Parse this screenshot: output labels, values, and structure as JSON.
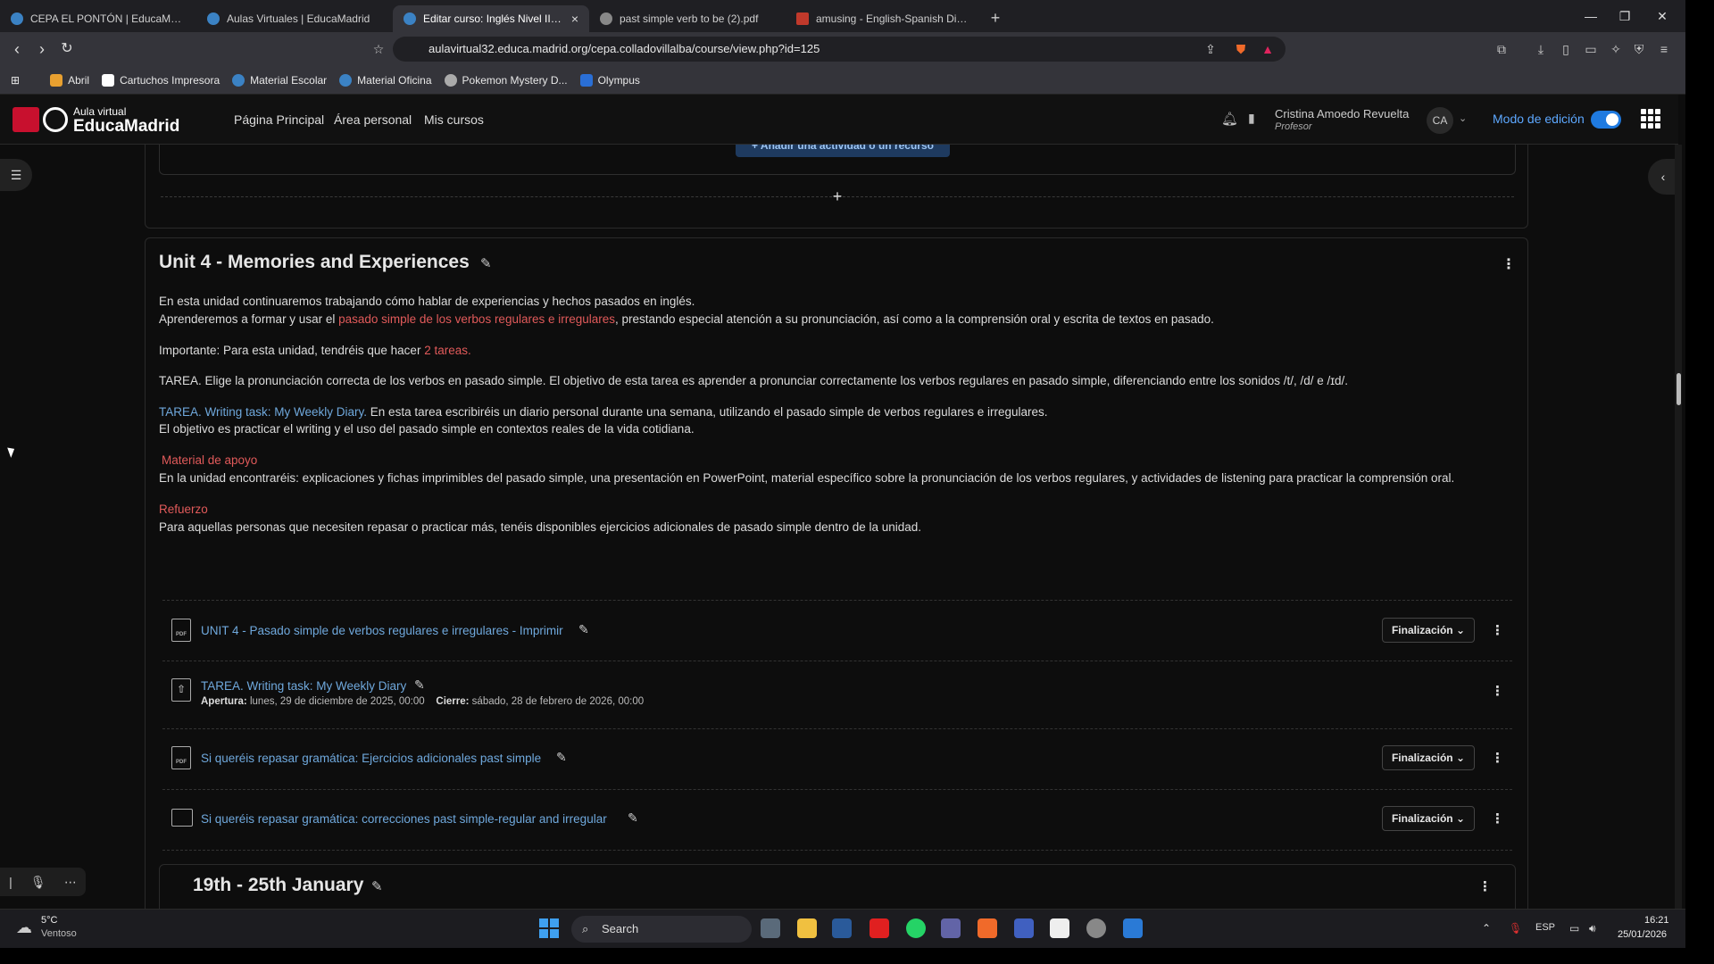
{
  "browser": {
    "tabs": [
      {
        "label": "CEPA EL PONTÓN | EducaMadrid"
      },
      {
        "label": "Aulas Virtuales | EducaMadrid"
      },
      {
        "label": "Editar curso: Inglés Nivel II Dista",
        "active": true
      },
      {
        "label": "past simple verb to be (2).pdf"
      },
      {
        "label": "amusing - English-Spanish Dictionar"
      }
    ],
    "url": "aulavirtual32.educa.madrid.org/cepa.colladovillalba/course/view.php?id=125",
    "bookmarks": [
      "Abril",
      "Cartuchos Impresora",
      "Material Escolar",
      "Material Oficina",
      "Pokemon Mystery D...",
      "Olympus"
    ]
  },
  "site": {
    "logo_line1": "Aula virtual",
    "logo_line2": "EducaMadrid",
    "nav": [
      "Página Principal",
      "Área personal",
      "Mis cursos"
    ],
    "user_name": "Cristina Amoedo Revuelta",
    "user_role": "Profesor",
    "user_initials": "CA",
    "edit_mode_label": "Modo de edición",
    "edit_mode_on": true
  },
  "prev_section": {
    "add_activity_label": "+ Añadir una actividad o un recurso"
  },
  "unit": {
    "title": "Unit 4 - Memories and Experiences",
    "p1": "En esta unidad continuaremos trabajando cómo hablar de experiencias y hechos pasados en inglés.",
    "p2_a": "Aprenderemos a formar y usar el ",
    "p2_red": "pasado simple de los verbos regulares e irregulares",
    "p2_b": ", prestando especial atención a su pronunciación, así como a la comprensión oral y escrita de textos en pasado.",
    "p3_a": "Importante: Para esta unidad, tendréis que hacer ",
    "p3_red": "2 tareas.",
    "p4": "TAREA. Elige la pronunciación correcta de los verbos en pasado simple. El objetivo de esta tarea es aprender a pronunciar correctamente los verbos regulares en pasado simple, diferenciando entre los sonidos /t/, /d/ e /ɪd/.",
    "p5_link": "TAREA. Writing task: My Weekly Diary.",
    "p5_b": " En esta tarea escribiréis un diario personal durante una semana, utilizando el pasado simple de verbos regulares e irregulares.",
    "p6": "El objetivo es practicar el writing y el uso del pasado simple en contextos reales de la vida cotidiana.",
    "h_material": "Material de apoyo",
    "p7": "En la unidad encontraréis: explicaciones y fichas imprimibles del pasado simple, una presentación en PowerPoint, material específico sobre la pronunciación de los verbos regulares, y actividades de listening para practicar la comprensión oral.",
    "h_refuerzo": "Refuerzo",
    "p8": "Para aquellas personas que necesiten repasar o practicar más, tenéis disponibles ejercicios adicionales de pasado simple dentro de la unidad."
  },
  "activities": [
    {
      "icon": "pdf",
      "title": "UNIT 4 - Pasado simple de verbos regulares e irregulares - Imprimir",
      "completion": "Finalización"
    },
    {
      "icon": "assign",
      "title": "TAREA. Writing task: My Weekly Diary",
      "open_label": "Apertura:",
      "open_value": "lunes, 29 de diciembre de 2025, 00:00",
      "close_label": "Cierre:",
      "close_value": "sábado, 28 de febrero de 2026, 00:00"
    },
    {
      "icon": "pdf",
      "title": "Si queréis repasar gramática: Ejercicios adicionales past simple",
      "completion": "Finalización"
    },
    {
      "icon": "folder",
      "title": "Si queréis repasar gramática: correcciones past simple-regular and irregular",
      "completion": "Finalización"
    }
  ],
  "next_section": {
    "title": "19th - 25th January"
  },
  "taskbar": {
    "weather_temp": "5°C",
    "weather_desc": "Ventoso",
    "search_label": "Search",
    "lang": "ESP",
    "time": "16:21",
    "date": "25/01/2026"
  }
}
